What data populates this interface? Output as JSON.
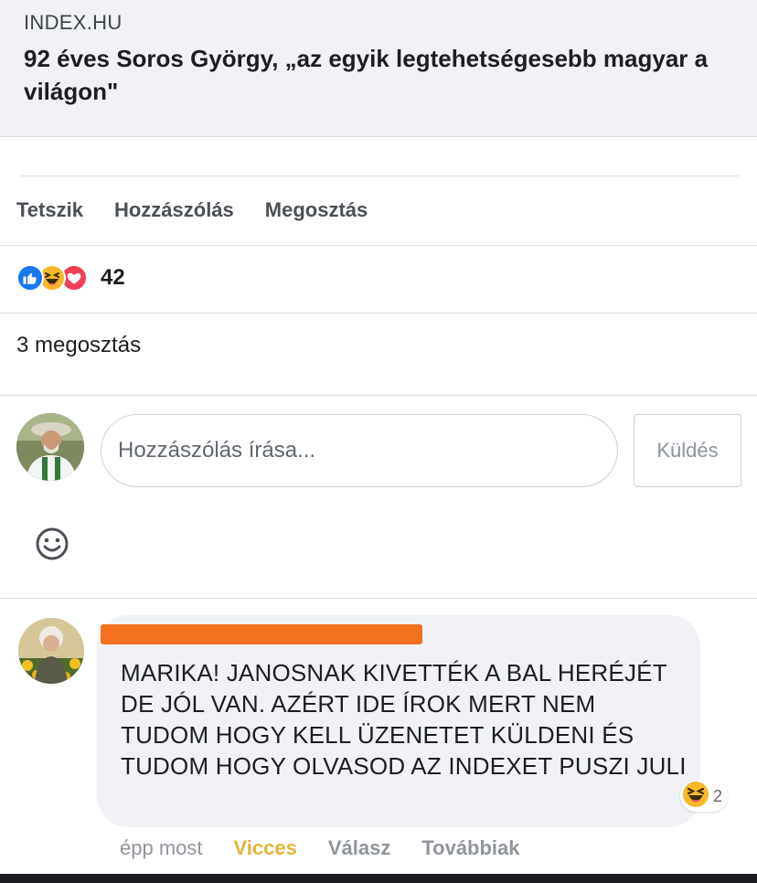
{
  "link_preview": {
    "domain": "INDEX.HU",
    "title": "92 éves Soros György, „az egyik legtehetségesebb magyar a világon\""
  },
  "actions": {
    "like": "Tetszik",
    "comment": "Hozzászólás",
    "share": "Megosztás"
  },
  "reactions": {
    "icons": [
      "like-icon",
      "haha-icon",
      "love-icon"
    ],
    "count": "42"
  },
  "shares": {
    "text": "3 megosztás"
  },
  "composer": {
    "placeholder": "Hozzászólás írása...",
    "send_label": "Küldés"
  },
  "comment": {
    "text": "MARIKA! JANOSNAK KIVETTÉK A BAL HERÉJÉT DE JÓL VAN. AZÉRT IDE ÍROK MERT NEM TUDOM HOGY KELL ÜZENETET KÜLDENI ÉS TUDOM HOGY OLVASOD AZ INDEXET PUSZI JULI",
    "reaction_icon": "haha-icon",
    "reaction_count": "2",
    "time": "épp most",
    "active_reaction": "Vicces",
    "reply": "Válasz",
    "more": "Továbbiak"
  },
  "colors": {
    "like_blue": "#1877f2",
    "haha_yellow": "#f7b928",
    "love_red": "#f33e58",
    "redaction_orange": "#f37021",
    "vicces_gold": "#e5b33a"
  }
}
